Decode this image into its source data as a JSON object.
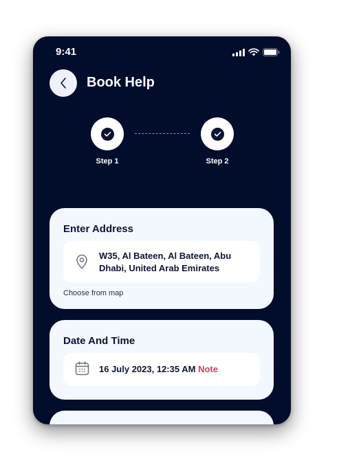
{
  "status": {
    "time": "9:41"
  },
  "header": {
    "title": "Book Help"
  },
  "steps": [
    {
      "label": "Step 1"
    },
    {
      "label": "Step 2"
    }
  ],
  "address": {
    "title": "Enter Address",
    "value": "W35, Al Bateen, Al Bateen, Abu Dhabi, United Arab Emirates",
    "choose_map": "Choose from map"
  },
  "datetime": {
    "title": "Date And Time",
    "value": "16 July 2023, 12:35 AM",
    "note": "Note"
  },
  "colors": {
    "background": "#020c2b",
    "card": "#f3f7fe",
    "accent": "#e0385e"
  }
}
